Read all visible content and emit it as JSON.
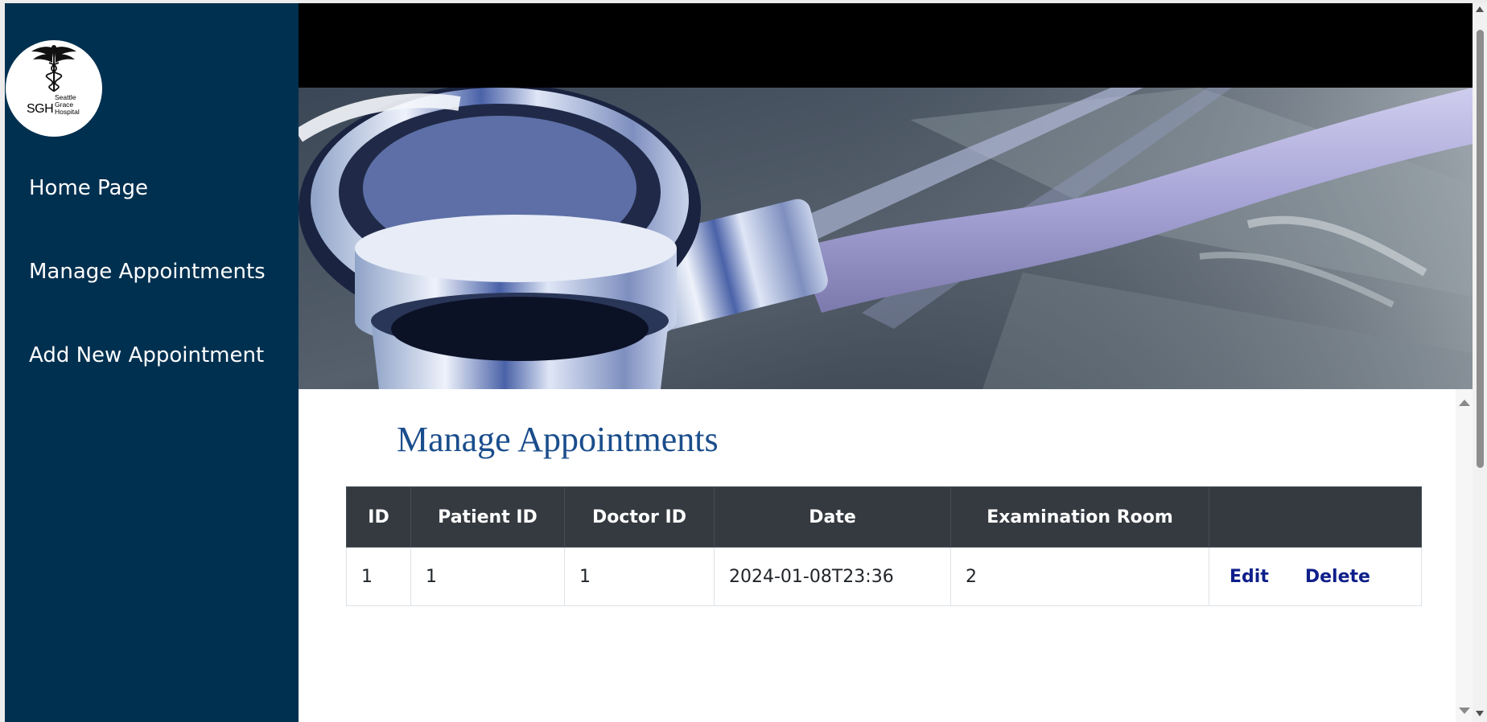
{
  "sidebar": {
    "logo": {
      "abbr": "SGH",
      "lines": [
        "Seattle",
        "Grace",
        "Hospital"
      ]
    },
    "items": [
      {
        "label": "Home Page"
      },
      {
        "label": "Manage Appointments"
      },
      {
        "label": "Add New Appointment"
      }
    ]
  },
  "main": {
    "title": "Manage Appointments",
    "table": {
      "headers": [
        "ID",
        "Patient ID",
        "Doctor ID",
        "Date",
        "Examination Room",
        ""
      ],
      "rows": [
        {
          "id": "1",
          "patient_id": "1",
          "doctor_id": "1",
          "date": "2024-01-08T23:36",
          "room": "2",
          "edit_label": "Edit",
          "delete_label": "Delete"
        }
      ]
    }
  },
  "colors": {
    "sidebar_bg": "#003050",
    "title": "#1a4d8c",
    "table_header_bg": "#343a40",
    "link": "#0f1f8a"
  }
}
